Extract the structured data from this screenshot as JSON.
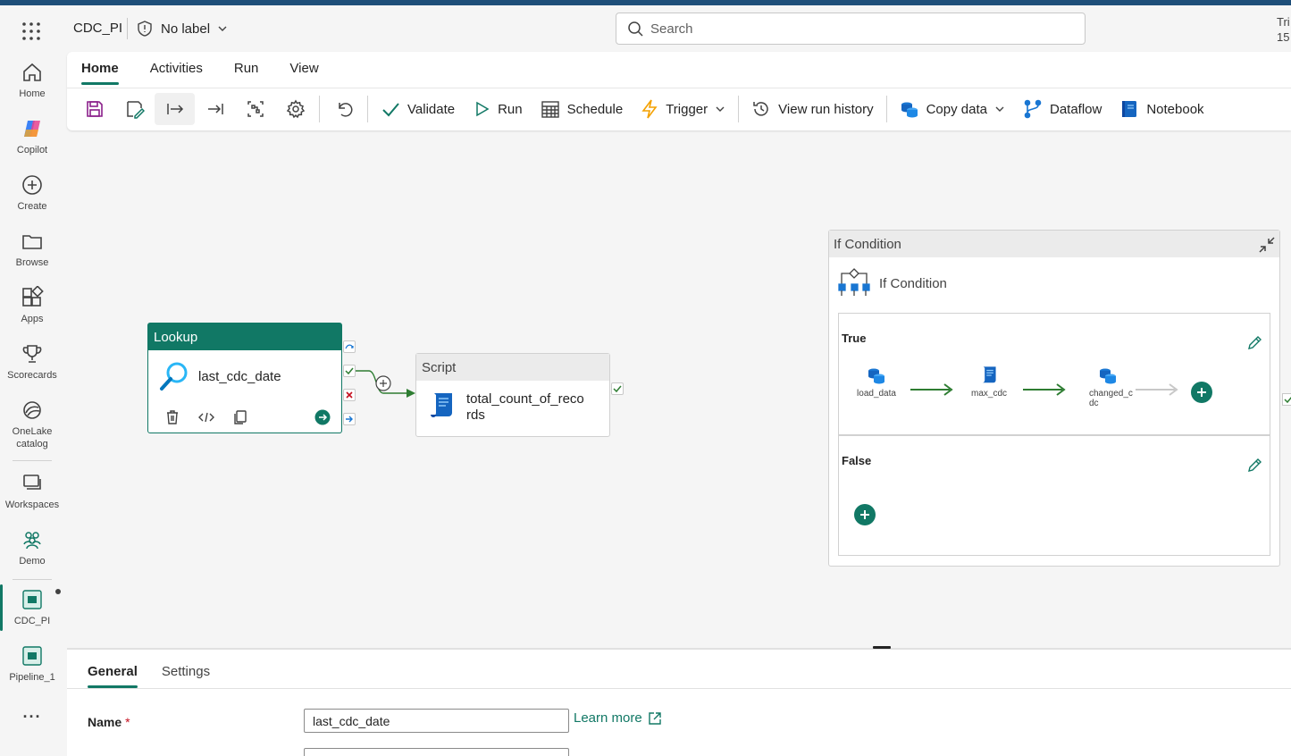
{
  "header": {
    "title": "CDC_PI",
    "label": "No label",
    "search_placeholder": "Search",
    "trial_line1": "Tri",
    "trial_line2": "15"
  },
  "rail": {
    "items": [
      {
        "label": "Home",
        "icon": "home-icon"
      },
      {
        "label": "Copilot",
        "icon": "copilot-icon"
      },
      {
        "label": "Create",
        "icon": "plus-circle-icon"
      },
      {
        "label": "Browse",
        "icon": "folder-icon"
      },
      {
        "label": "Apps",
        "icon": "apps-icon"
      },
      {
        "label": "Scorecards",
        "icon": "trophy-icon"
      },
      {
        "label": "OneLake",
        "label2": "catalog",
        "icon": "onelake-icon"
      },
      {
        "label": "Workspaces",
        "icon": "workspaces-icon"
      },
      {
        "label": "Demo",
        "icon": "demo-icon"
      },
      {
        "label": "CDC_PI",
        "icon": "pipeline-icon"
      },
      {
        "label": "Pipeline_1",
        "icon": "pipeline-icon"
      }
    ],
    "more": "···"
  },
  "ribbon": {
    "tabs": [
      "Home",
      "Activities",
      "Run",
      "View"
    ],
    "active_tab": "Home",
    "buttons": {
      "validate": "Validate",
      "run": "Run",
      "schedule": "Schedule",
      "trigger": "Trigger",
      "view_run_history": "View run history",
      "copy_data": "Copy data",
      "dataflow": "Dataflow",
      "notebook": "Notebook"
    }
  },
  "canvas": {
    "lookup": {
      "type": "Lookup",
      "name": "last_cdc_date"
    },
    "script": {
      "type": "Script",
      "name_line1": "total_count_of_reco",
      "name_line2": "rds"
    },
    "if_condition": {
      "header": "If Condition",
      "title": "If Condition",
      "true_label": "True",
      "false_label": "False",
      "true_activities": [
        {
          "name": "load_data",
          "icon": "copy-data-icon"
        },
        {
          "name": "max_cdc",
          "icon": "script-icon"
        },
        {
          "name_line1": "changed_c",
          "name_line2": "dc",
          "icon": "copy-data-icon"
        }
      ]
    }
  },
  "panel": {
    "tabs": [
      "General",
      "Settings"
    ],
    "active_tab": "General",
    "name_label": "Name",
    "required_mark": "*",
    "name_value": "last_cdc_date",
    "learn_more": "Learn more"
  },
  "colors": {
    "accent": "#117865",
    "top_strip": "#1e4e79",
    "error": "#c50f1f"
  }
}
